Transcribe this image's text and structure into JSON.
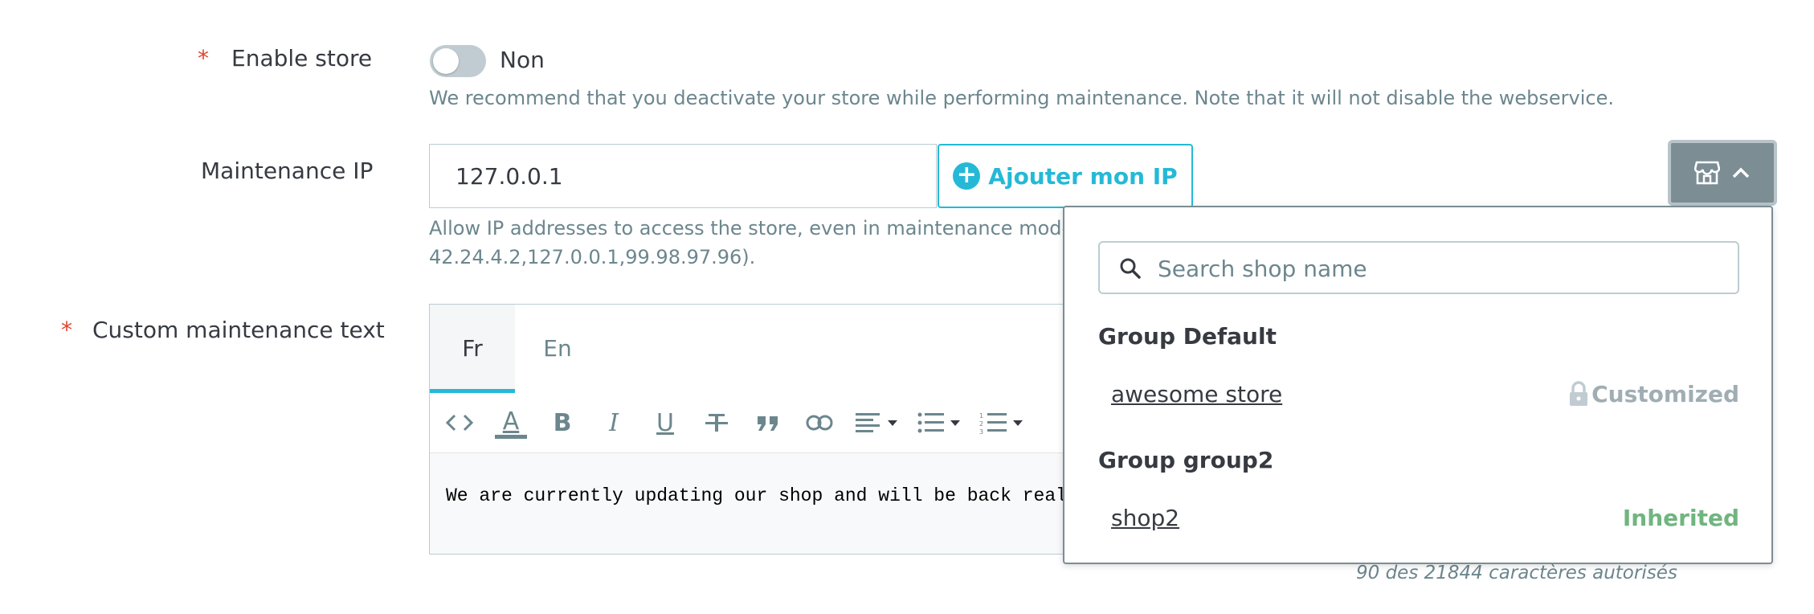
{
  "enable_store": {
    "label": "Enable store",
    "required_mark": "*",
    "toggle_state": "Non",
    "help": "We recommend that you deactivate your store while performing maintenance. Note that it will not disable the webservice."
  },
  "maintenance_ip": {
    "label": "Maintenance IP",
    "value": "127.0.0.1",
    "add_button": "Ajouter mon IP",
    "help_line1": "Allow IP addresses to access the store, even in maintenance mode. Use",
    "help_line2": "42.24.4.2,127.0.0.1,99.98.97.96)."
  },
  "custom_text": {
    "label": "Custom maintenance text",
    "required_mark": "*",
    "tabs": [
      {
        "label": "Fr",
        "active": true
      },
      {
        "label": "En",
        "active": false
      }
    ],
    "content": "We are currently updating our shop and will be back really soon. Tha",
    "char_count": "90 des 21844 caractères autorisés"
  },
  "shop_selector": {
    "search_placeholder": "Search shop name",
    "groups": [
      {
        "title": "Group Default",
        "shops": [
          {
            "name": "awesome store",
            "status": "Customized"
          }
        ]
      },
      {
        "title": "Group group2",
        "shops": [
          {
            "name": "shop2",
            "status": "Inherited"
          }
        ]
      }
    ]
  },
  "icons": [
    "store-icon",
    "chevron-up-icon",
    "search-icon",
    "lock-icon",
    "plus-circle-icon"
  ],
  "colors": {
    "primary": "#25b9d7",
    "required": "#e0442e",
    "inherited": "#70b580",
    "customized": "#a0aeb4",
    "selector_button": "#7c8d94"
  }
}
